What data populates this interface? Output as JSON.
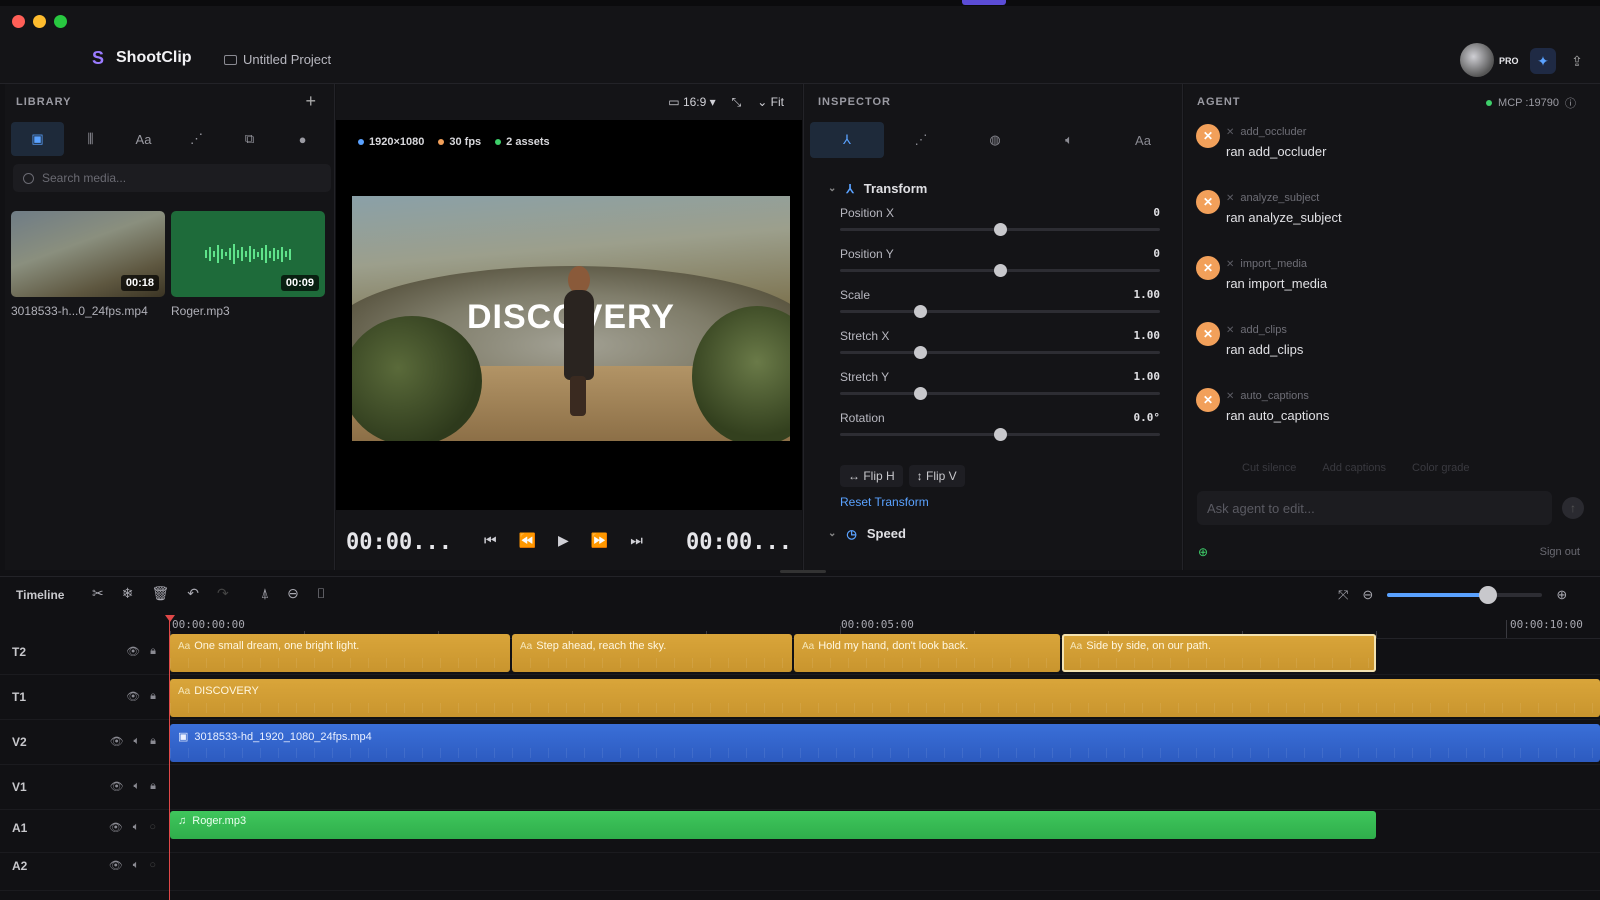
{
  "app": {
    "name": "ShootClip",
    "project": "Untitled Project",
    "plan": "PRO"
  },
  "library": {
    "title": "LIBRARY",
    "add_label": "+",
    "search_placeholder": "Search media...",
    "tabs": [
      "media-icon",
      "audio-icon",
      "text-icon",
      "effects-icon",
      "shapes-icon",
      "color-icon"
    ],
    "text_tab_label": "Aa",
    "items": [
      {
        "name": "3018533-h...0_24fps.mp4",
        "duration": "00:18",
        "type": "video"
      },
      {
        "name": "Roger.mp3",
        "duration": "00:09",
        "type": "audio"
      }
    ]
  },
  "preview": {
    "aspect": "16:9",
    "fit_label": "Fit",
    "chips": [
      {
        "label": "1920×1080",
        "color": "#5aa2ff"
      },
      {
        "label": "30 fps",
        "color": "#f2a05a"
      },
      {
        "label": "2 assets",
        "color": "#3ecf6a"
      }
    ],
    "overlay_text": "DISCOVERY",
    "timecode_current": "00:00...",
    "timecode_total": "00:00..."
  },
  "inspector": {
    "title": "INSPECTOR",
    "tab_text_label": "Aa",
    "transform_title": "Transform",
    "props": [
      {
        "label": "Position X",
        "value": "0",
        "fraction": 0.5
      },
      {
        "label": "Position Y",
        "value": "0",
        "fraction": 0.5
      },
      {
        "label": "Scale",
        "value": "1.00",
        "fraction": 0.25
      },
      {
        "label": "Stretch X",
        "value": "1.00",
        "fraction": 0.25
      },
      {
        "label": "Stretch Y",
        "value": "1.00",
        "fraction": 0.25
      },
      {
        "label": "Rotation",
        "value": "0.0°",
        "fraction": 0.5
      }
    ],
    "flip_h": "↔ Flip H",
    "flip_v": "↕ Flip V",
    "reset_label": "Reset Transform",
    "speed_title": "Speed"
  },
  "agent": {
    "title": "AGENT",
    "mcp": "MCP :19790",
    "items": [
      {
        "tool": "add_occluder",
        "result": "ran add_occluder"
      },
      {
        "tool": "analyze_subject",
        "result": "ran analyze_subject"
      },
      {
        "tool": "import_media",
        "result": "ran import_media"
      },
      {
        "tool": "add_clips",
        "result": "ran add_clips"
      },
      {
        "tool": "auto_captions",
        "result": "ran auto_captions"
      }
    ],
    "suggestions": [
      "Cut silence",
      "Add captions",
      "Color grade"
    ],
    "ask_placeholder": "Ask agent to edit...",
    "signout": "Sign out"
  },
  "timeline": {
    "title": "Timeline",
    "ruler": [
      "00:00:00:00",
      "00:00:05:00",
      "00:00:10:00"
    ],
    "zoom_fraction": 0.65,
    "tracks": [
      {
        "id": "T2",
        "clips": [
          {
            "label": "One small dream, one bright light."
          },
          {
            "label": "Step ahead, reach the sky."
          },
          {
            "label": "Hold my hand, don't look back."
          },
          {
            "label": "Side by side, on our path."
          }
        ]
      },
      {
        "id": "T1",
        "clips": [
          {
            "label": "DISCOVERY"
          }
        ]
      },
      {
        "id": "V2",
        "clips": [
          {
            "label": "3018533-hd_1920_1080_24fps.mp4"
          }
        ]
      },
      {
        "id": "V1",
        "clips": []
      },
      {
        "id": "A1",
        "clips": [
          {
            "label": "Roger.mp3"
          }
        ]
      },
      {
        "id": "A2",
        "clips": []
      }
    ]
  }
}
